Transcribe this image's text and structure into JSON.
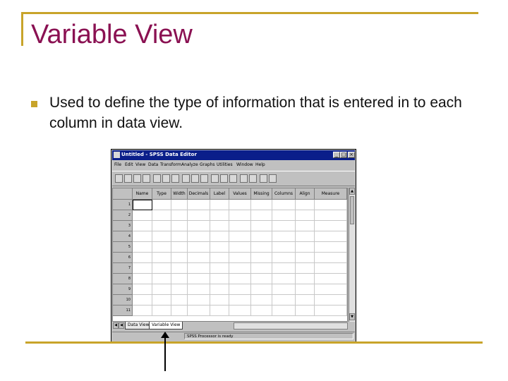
{
  "slide": {
    "title": "Variable View",
    "bullet": "Used to define the type of information  that is entered in to each column in data view."
  },
  "colors": {
    "title": "#8a1152",
    "accent": "#c8a42a",
    "window_titlebar": "#0a1e8a"
  },
  "window": {
    "title": "Untitled - SPSS Data Editor",
    "controls": [
      "minimize-icon",
      "maximize-icon",
      "close-icon"
    ],
    "menu": [
      "File",
      "Edit",
      "View",
      "Data",
      "Transform",
      "Analyze",
      "Graphs",
      "Utilities",
      "Window",
      "Help"
    ],
    "toolbar_icons": [
      "open-icon",
      "save-icon",
      "print-icon",
      "dialog-recall-icon",
      "undo-icon",
      "redo-icon",
      "goto-chart-icon",
      "goto-case-icon",
      "variables-icon",
      "find-icon",
      "insert-case-icon",
      "insert-variable-icon",
      "split-file-icon",
      "weight-cases-icon",
      "select-cases-icon",
      "value-labels-icon",
      "use-sets-icon"
    ],
    "columns": [
      "Name",
      "Type",
      "Width",
      "Decimals",
      "Label",
      "Values",
      "Missing",
      "Columns",
      "Align",
      "Measure"
    ],
    "rows": [
      "1",
      "2",
      "3",
      "4",
      "5",
      "6",
      "7",
      "8",
      "9",
      "10",
      "11"
    ],
    "tabs": [
      "Data View",
      "Variable View"
    ],
    "active_tab": "Variable View",
    "status": "SPSS Processor is ready"
  }
}
